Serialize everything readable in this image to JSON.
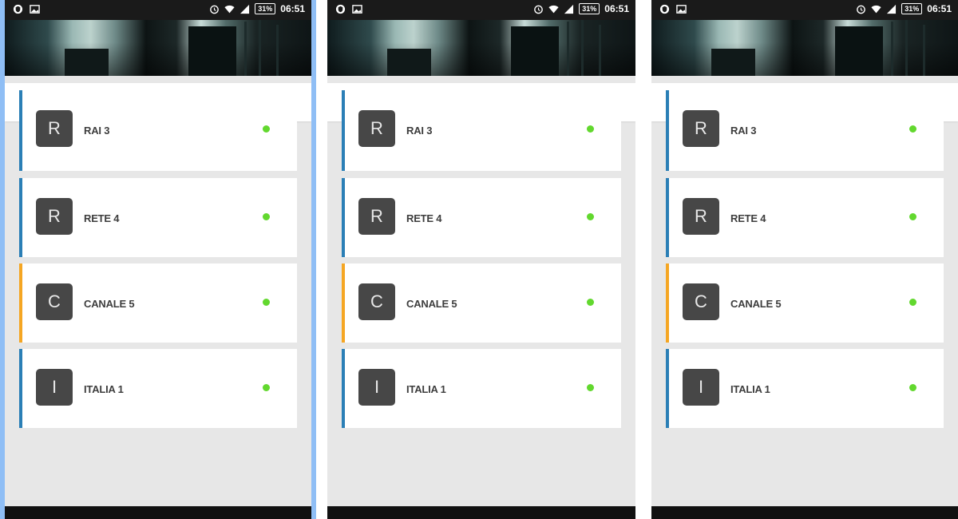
{
  "colors": {
    "accent_blue": "#2b7fb6",
    "accent_orange": "#f5a623",
    "online_dot": "#62d82e",
    "avatar_bg": "#474747",
    "background": "#e7e7e7",
    "divider_left": "#8fbef5"
  },
  "status_bar": {
    "battery": "31%",
    "time": "06:51",
    "left_icons": [
      "shield-icon",
      "image-icon"
    ],
    "right_icons": [
      "alarm-icon",
      "wifi-icon",
      "signal-icon",
      "battery-icon"
    ]
  },
  "search": {
    "icon": "search-icon",
    "placeholder": ""
  },
  "channels": [
    {
      "letter": "R",
      "name": "RAI 3",
      "accent": "#2b7fb6",
      "status": "online"
    },
    {
      "letter": "R",
      "name": "RETE 4",
      "accent": "#2b7fb6",
      "status": "online"
    },
    {
      "letter": "C",
      "name": "CANALE 5",
      "accent": "#f5a623",
      "status": "online"
    },
    {
      "letter": "I",
      "name": "ITALIA 1",
      "accent": "#2b7fb6",
      "status": "online"
    }
  ]
}
